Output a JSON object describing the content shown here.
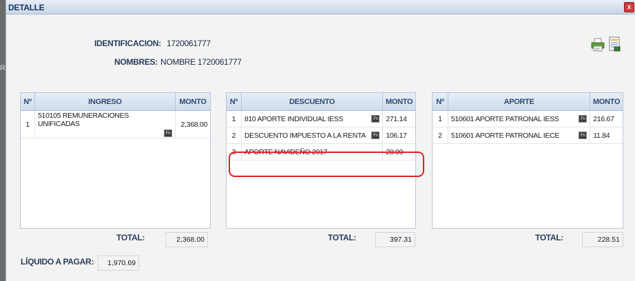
{
  "dialog": {
    "title": "DETALLE",
    "close_label": "x"
  },
  "left_edge_glyph": "R",
  "info": {
    "id_label": "IDENTIFICACION:",
    "id_value": "1720061777",
    "name_label": "NOMBRES:",
    "name_value": "NOMBRE 1720061777"
  },
  "toolbar": {
    "icons": [
      "printer-icon",
      "report-icon"
    ]
  },
  "ingreso": {
    "headers": {
      "num": "Nº",
      "concept": "INGRESO",
      "amount": "MONTO"
    },
    "rows": [
      {
        "n": "1",
        "concept": "510105 REMUNERACIONES UNIFICADAS",
        "amount": "2,368.00"
      }
    ],
    "total_label": "TOTAL:",
    "total": "2,368.00"
  },
  "descuento": {
    "headers": {
      "num": "Nº",
      "concept": "DESCUENTO",
      "amount": "MONTO"
    },
    "rows": [
      {
        "n": "1",
        "concept": "810 APORTE INDIVIDUAL IESS",
        "amount": "271.14"
      },
      {
        "n": "2",
        "concept": "DESCUENTO IMPUESTO A LA RENTA",
        "amount": "106.17"
      },
      {
        "n": "3",
        "concept": "APORTE NAVIDEÑO 2017",
        "amount": "20.00"
      }
    ],
    "total_label": "TOTAL:",
    "total": "397.31"
  },
  "aporte": {
    "headers": {
      "num": "Nº",
      "concept": "APORTE",
      "amount": "MONTO"
    },
    "rows": [
      {
        "n": "1",
        "concept": "510601 APORTE PATRONAL IESS",
        "amount": "216.67"
      },
      {
        "n": "2",
        "concept": "510601 APORTE PATRONAL IECE",
        "amount": "11.84"
      }
    ],
    "total_label": "TOTAL:",
    "total": "228.51"
  },
  "liquido": {
    "label": "LÍQUIDO A PAGAR:",
    "value": "1,970.69"
  },
  "fn_icon_text": "Fn",
  "colors": {
    "highlight": "#e02020",
    "header_text": "#2b4a73",
    "border": "#b8c6d6"
  }
}
